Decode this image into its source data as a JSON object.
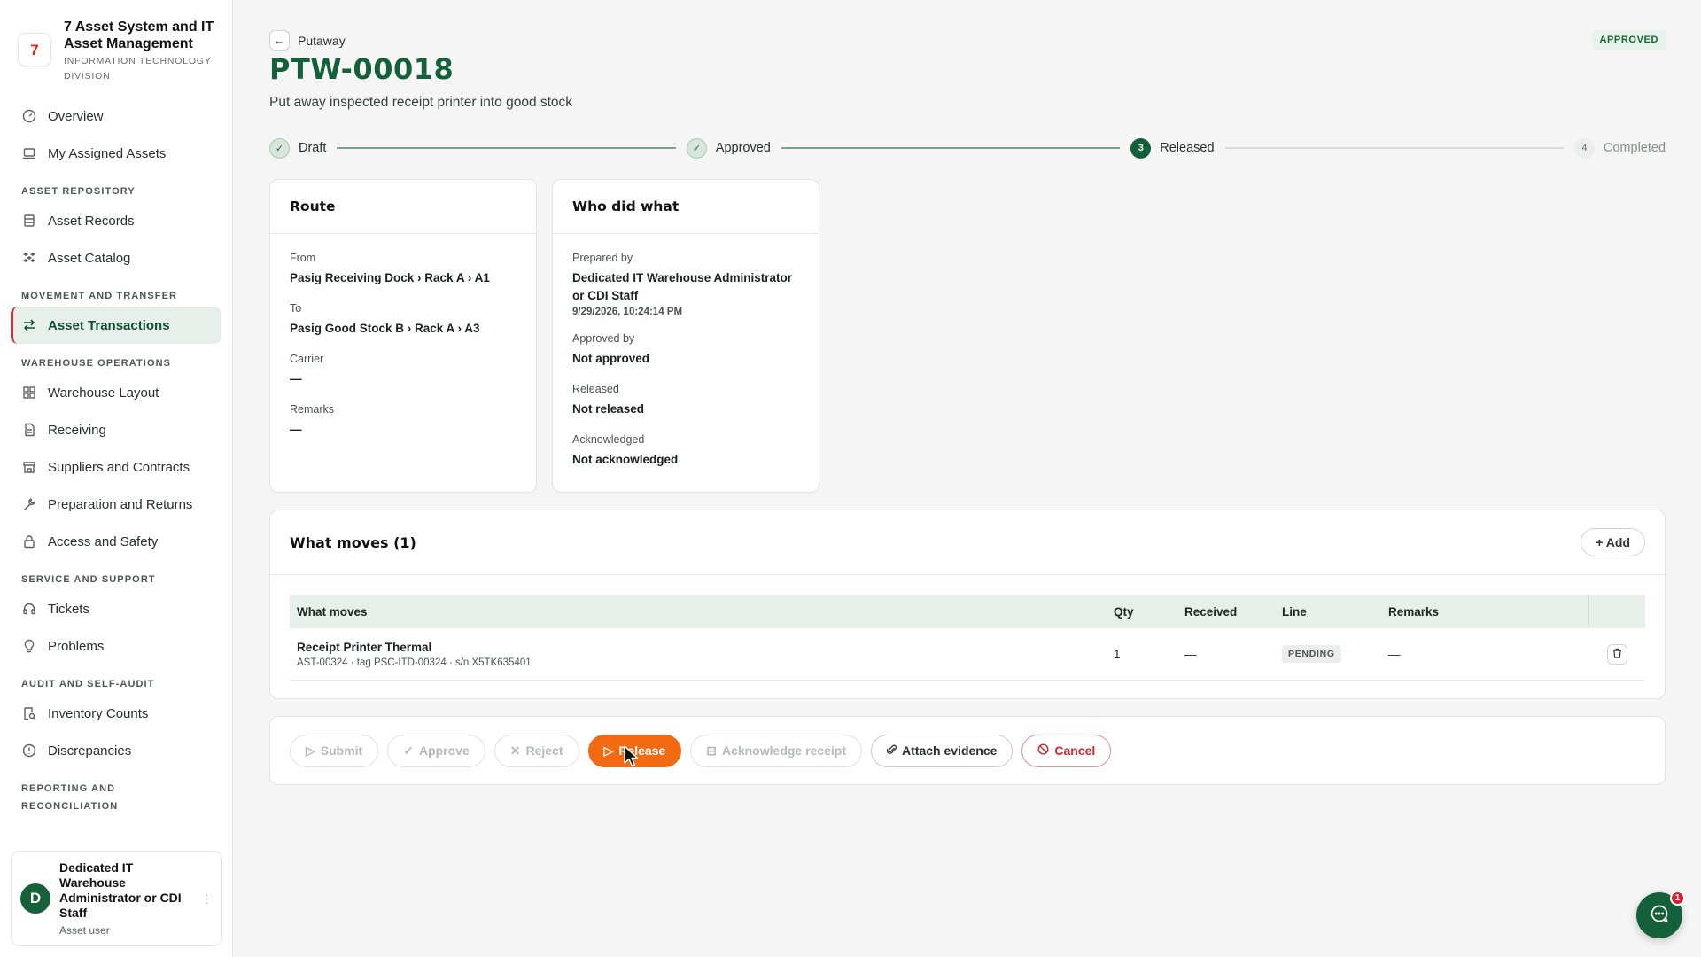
{
  "brand": {
    "title": "7 Asset System and IT Asset Management",
    "subtitle": "INFORMATION TECHNOLOGY DIVISION",
    "logo_text": "7"
  },
  "sidebar": {
    "top_items": [
      {
        "label": "Overview",
        "icon": "gauge-icon"
      },
      {
        "label": "My Assigned Assets",
        "icon": "laptop-icon"
      }
    ],
    "sections": [
      {
        "title": "ASSET REPOSITORY",
        "items": [
          {
            "label": "Asset Records",
            "icon": "database-icon"
          },
          {
            "label": "Asset Catalog",
            "icon": "boxes-icon"
          }
        ]
      },
      {
        "title": "MOVEMENT AND TRANSFER",
        "items": [
          {
            "label": "Asset Transactions",
            "icon": "arrows-icon",
            "active": true
          }
        ]
      },
      {
        "title": "WAREHOUSE OPERATIONS",
        "items": [
          {
            "label": "Warehouse Layout",
            "icon": "grid-icon"
          },
          {
            "label": "Receiving",
            "icon": "document-icon"
          },
          {
            "label": "Suppliers and Contracts",
            "icon": "store-icon"
          },
          {
            "label": "Preparation and Returns",
            "icon": "wrench-icon"
          },
          {
            "label": "Access and Safety",
            "icon": "lock-icon"
          }
        ]
      },
      {
        "title": "SERVICE AND SUPPORT",
        "items": [
          {
            "label": "Tickets",
            "icon": "headset-icon"
          },
          {
            "label": "Problems",
            "icon": "lightbulb-icon"
          }
        ]
      },
      {
        "title": "AUDIT AND SELF-AUDIT",
        "items": [
          {
            "label": "Inventory Counts",
            "icon": "clipboard-search-icon"
          },
          {
            "label": "Discrepancies",
            "icon": "alert-circle-icon"
          }
        ]
      },
      {
        "title": "REPORTING AND RECONCILIATION",
        "items": []
      }
    ],
    "user": {
      "initial": "D",
      "name": "Dedicated IT Warehouse Administrator or CDI Staff",
      "role": "Asset user"
    }
  },
  "header": {
    "breadcrumb": "Putaway",
    "status": "APPROVED",
    "title": "PTW-00018",
    "subtitle": "Put away inspected receipt printer into good stock"
  },
  "stepper": [
    {
      "label": "Draft",
      "state": "done",
      "marker": "✓"
    },
    {
      "label": "Approved",
      "state": "done",
      "marker": "✓"
    },
    {
      "label": "Released",
      "state": "current",
      "marker": "3"
    },
    {
      "label": "Completed",
      "state": "todo",
      "marker": "4"
    }
  ],
  "route": {
    "title": "Route",
    "from_label": "From",
    "from_value": "Pasig Receiving Dock › Rack A › A1",
    "to_label": "To",
    "to_value": "Pasig Good Stock B › Rack A › A3",
    "carrier_label": "Carrier",
    "carrier_value": "—",
    "remarks_label": "Remarks",
    "remarks_value": "—"
  },
  "who": {
    "title": "Who did what",
    "prepared_label": "Prepared by",
    "prepared_value": "Dedicated IT Warehouse Administrator or CDI Staff",
    "prepared_time": "9/29/2026, 10:24:14 PM",
    "approved_label": "Approved by",
    "approved_value": "Not approved",
    "released_label": "Released",
    "released_value": "Not released",
    "ack_label": "Acknowledged",
    "ack_value": "Not acknowledged"
  },
  "moves": {
    "title": "What moves (1)",
    "add_label": "Add",
    "columns": [
      "What moves",
      "Qty",
      "Received",
      "Line",
      "Remarks"
    ],
    "rows": [
      {
        "name": "Receipt Printer Thermal",
        "meta": "AST-00324 · tag PSC-ITD-00324 · s/n X5TK635401",
        "qty": "1",
        "received": "—",
        "line": "PENDING",
        "remarks": "—"
      }
    ]
  },
  "actions": {
    "submit": "Submit",
    "approve": "Approve",
    "reject": "Reject",
    "release": "Release",
    "acknowledge": "Acknowledge receipt",
    "attach": "Attach evidence",
    "cancel": "Cancel"
  },
  "chat": {
    "badge": "1"
  },
  "colors": {
    "brand_green": "#14603a",
    "release_orange": "#f26a12",
    "cancel_red": "#d0272f",
    "active_marker": "#d62d3a"
  }
}
